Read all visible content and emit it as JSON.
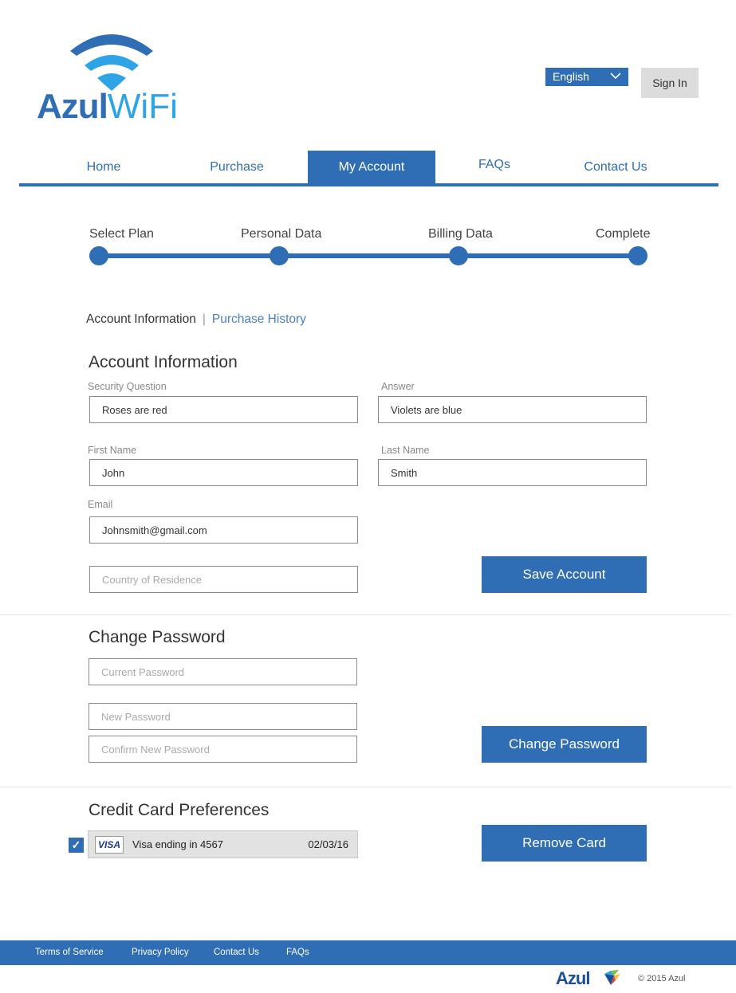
{
  "brand": {
    "name_bold": "Azul",
    "name_light": "WiFi"
  },
  "header": {
    "language": "English",
    "sign_in": "Sign In"
  },
  "nav": {
    "items": [
      {
        "label": "Home"
      },
      {
        "label": "Purchase"
      },
      {
        "label": "My Account"
      },
      {
        "label": "FAQs"
      },
      {
        "label": "Contact Us"
      }
    ],
    "active": "My Account"
  },
  "stepper": {
    "steps": [
      {
        "label": "Select Plan"
      },
      {
        "label": "Personal Data"
      },
      {
        "label": "Billing Data"
      },
      {
        "label": "Complete"
      }
    ]
  },
  "sub_tabs": {
    "current": "Account Information",
    "separator": "|",
    "other": "Purchase History"
  },
  "account": {
    "title": "Account Information",
    "security_question": {
      "label": "Security Question",
      "value": "Roses are red"
    },
    "answer": {
      "label": "Answer",
      "value": "Violets are blue"
    },
    "first_name": {
      "label": "First Name",
      "value": "John"
    },
    "last_name": {
      "label": "Last Name",
      "value": "Smith"
    },
    "email": {
      "label": "Email",
      "value": "Johnsmith@gmail.com"
    },
    "country": {
      "placeholder": "Country of Residence"
    },
    "save_button": "Save Account"
  },
  "password": {
    "title": "Change Password",
    "current_placeholder": "Current Password",
    "new_placeholder": "New Password",
    "confirm_placeholder": "Confirm New Password",
    "button": "Change Password"
  },
  "credit_card": {
    "title": "Credit Card Preferences",
    "checked": true,
    "check_glyph": "✓",
    "brand": "VISA",
    "description": "Visa ending in 4567",
    "expiry": "02/03/16",
    "remove_button": "Remove Card"
  },
  "footer": {
    "links": [
      {
        "label": "Terms of Service"
      },
      {
        "label": "Privacy Policy"
      },
      {
        "label": "Contact Us"
      },
      {
        "label": "FAQs"
      }
    ],
    "logo_text": "Azul",
    "copyright": "© 2015 Azul"
  },
  "colors": {
    "primary": "#2f6db5",
    "accent": "#2ea4e6",
    "footer_logo": "#1d4e9a"
  }
}
